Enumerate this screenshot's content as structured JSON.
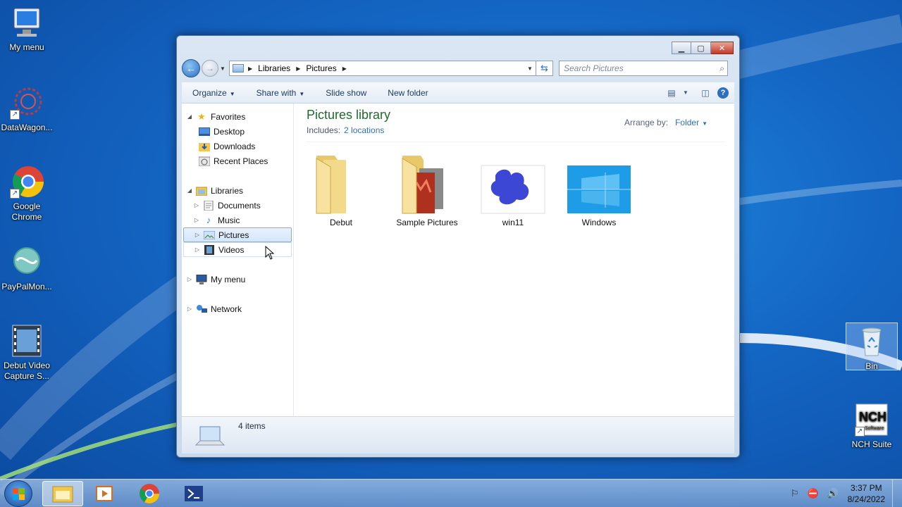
{
  "desktop": {
    "icons": [
      {
        "label": "My menu"
      },
      {
        "label": "DataWagon..."
      },
      {
        "label": "Google Chrome"
      },
      {
        "label": "PayPalMon..."
      },
      {
        "label": "Debut Video Capture S..."
      },
      {
        "label": "Bin"
      },
      {
        "label": "NCH Suite"
      }
    ]
  },
  "window": {
    "address": {
      "crumbs": [
        "Libraries",
        "Pictures"
      ]
    },
    "search": {
      "placeholder": "Search Pictures"
    },
    "toolbar": {
      "organize": "Organize",
      "share_with": "Share with",
      "slide_show": "Slide show",
      "new_folder": "New folder"
    },
    "nav": {
      "favorites": "Favorites",
      "desktop": "Desktop",
      "downloads": "Downloads",
      "recent": "Recent Places",
      "libraries": "Libraries",
      "documents": "Documents",
      "music": "Music",
      "pictures": "Pictures",
      "videos": "Videos",
      "my_menu": "My menu",
      "network": "Network"
    },
    "library": {
      "title": "Pictures library",
      "includes_label": "Includes:",
      "locations": "2 locations",
      "arrange_label": "Arrange by:",
      "arrange_value": "Folder"
    },
    "items": [
      {
        "name": "Debut",
        "kind": "folder"
      },
      {
        "name": "Sample Pictures",
        "kind": "folder-with-photo"
      },
      {
        "name": "win11",
        "kind": "image-blue-shape"
      },
      {
        "name": "Windows",
        "kind": "image-windows-logo"
      }
    ],
    "status": {
      "count": "4 items"
    }
  },
  "taskbar": {
    "time": "3:37 PM",
    "date": "8/24/2022"
  },
  "colors": {
    "library_title": "#1e6b2e",
    "link": "#2f6fc0",
    "desktop_bg": "#1466c4"
  }
}
